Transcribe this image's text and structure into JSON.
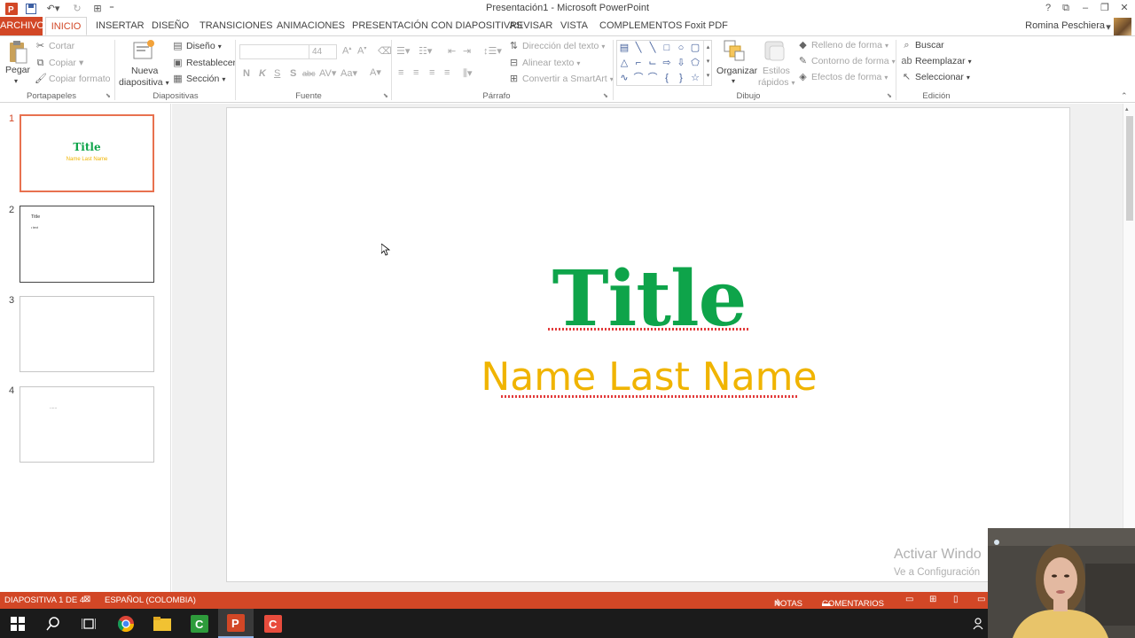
{
  "window": {
    "title": "Presentación1 - Microsoft PowerPoint",
    "user": "Romina Peschiera"
  },
  "tabs": [
    {
      "label": "ARCHIVO"
    },
    {
      "label": "INICIO"
    },
    {
      "label": "INSERTAR"
    },
    {
      "label": "DISEÑO"
    },
    {
      "label": "TRANSICIONES"
    },
    {
      "label": "ANIMACIONES"
    },
    {
      "label": "PRESENTACIÓN CON DIAPOSITIVAS"
    },
    {
      "label": "REVISAR"
    },
    {
      "label": "VISTA"
    },
    {
      "label": "COMPLEMENTOS"
    },
    {
      "label": "Foxit PDF"
    }
  ],
  "ribbon": {
    "portapapeles": {
      "pegar": "Pegar",
      "cortar": "Cortar",
      "copiar": "Copiar",
      "copiar_formato": "Copiar formato",
      "label": "Portapapeles"
    },
    "diapositivas": {
      "nueva_1": "Nueva",
      "nueva_2": "diapositiva",
      "diseno": "Diseño",
      "restablecer": "Restablecer",
      "seccion": "Sección",
      "label": "Diapositivas"
    },
    "fuente": {
      "size": "44",
      "bold": "N",
      "italic": "K",
      "underline": "S",
      "shadow": "S",
      "strike": "abc",
      "label": "Fuente"
    },
    "parrafo": {
      "direccion": "Dirección del texto",
      "alinear": "Alinear texto",
      "convertir": "Convertir a SmartArt",
      "label": "Párrafo"
    },
    "dibujo": {
      "organizar": "Organizar",
      "estilos_1": "Estilos",
      "estilos_2": "rápidos",
      "relleno": "Relleno de forma",
      "contorno": "Contorno de forma",
      "efectos": "Efectos de forma",
      "label": "Dibujo"
    },
    "edicion": {
      "buscar": "Buscar",
      "reemplazar": "Reemplazar",
      "seleccionar": "Seleccionar",
      "label": "Edición"
    }
  },
  "thumbnails": [
    {
      "number": "1",
      "title": "Title",
      "subtitle": "Name Last Name"
    },
    {
      "number": "2",
      "title": "Title",
      "bullet": "• text"
    },
    {
      "number": "3"
    },
    {
      "number": "4",
      "text": "......"
    }
  ],
  "slide": {
    "title": "Title",
    "subtitle": "Name Last Name"
  },
  "watermark": {
    "line1": "Activar Windo",
    "line2": "Ve a Configuración"
  },
  "status": {
    "slide_info": "DIAPOSITIVA 1 DE 4",
    "language": "ESPAÑOL (COLOMBIA)",
    "notas": "NOTAS",
    "comentarios": "COMENTARIOS"
  },
  "colors": {
    "accent": "#d24726",
    "title_green": "#0ea44a",
    "subtitle_gold": "#f0b400"
  }
}
